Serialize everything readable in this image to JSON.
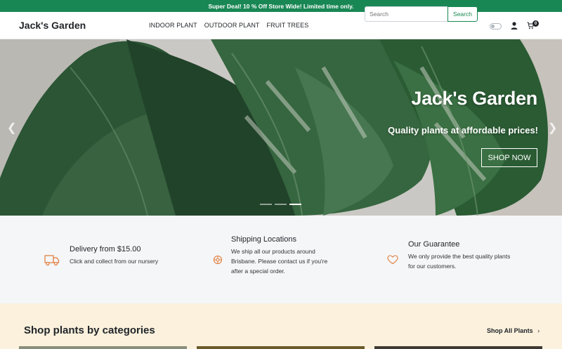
{
  "promo": {
    "text": "Super Deal! 10 % Off Store Wide! Limited time only."
  },
  "header": {
    "brand": "Jack's Garden",
    "menu": [
      "INDOOR PLANT",
      "OUTDOOR PLANT",
      "FRUIT TREES"
    ],
    "search_placeholder": "Search",
    "search_button": "Search",
    "cart_count": "0"
  },
  "hero": {
    "title": "Jack's Garden",
    "subtitle": "Quality plants at affordable prices!",
    "cta": "SHOP NOW",
    "slides": 3,
    "active_slide": 3
  },
  "features": [
    {
      "icon": "truck-icon",
      "title": "Delivery from $15.00",
      "text": [
        "Click and collect from our nursery"
      ]
    },
    {
      "icon": "location-icon",
      "title": "Shipping Locations",
      "text": [
        "We ship all our products around",
        "Brisbane. Please contact us if you're",
        "after a special order."
      ]
    },
    {
      "icon": "heart-icon",
      "title": "Our Guarantee",
      "text": [
        "We only provide the best quality plants",
        "for our customers."
      ]
    }
  ],
  "categories": {
    "title": "Shop plants by categories",
    "link": "Shop All Plants"
  },
  "colors": {
    "promo_bg": "#198754",
    "accent": "#e07b39",
    "features_bg": "#f5f6f8",
    "categories_bg": "#fbf1dd"
  }
}
